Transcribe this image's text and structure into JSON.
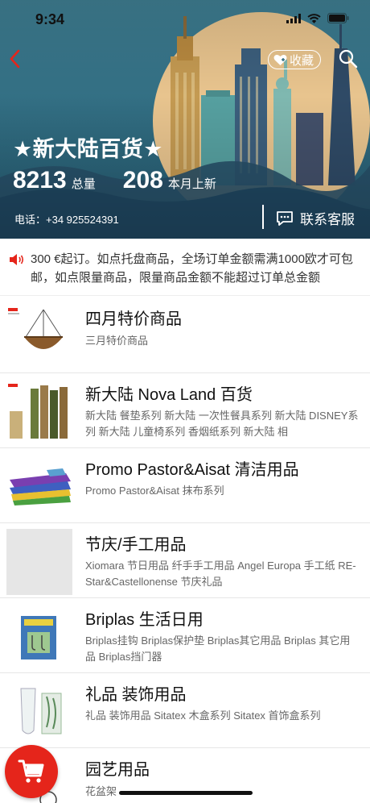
{
  "status_bar": {
    "time": "9:34"
  },
  "header": {
    "favorite_label": "收藏",
    "store_name": "★新大陆百货★",
    "total_count": "8213",
    "total_label": "总量",
    "new_count": "208",
    "new_label": "本月上新",
    "phone": "电话：+34 925524391",
    "contact_label": "联系客服"
  },
  "notice": {
    "text": "300 €起订。如点托盘商品，全场订单金额需满1000欧才可包邮，如点限量商品，限量商品金额不能超过订单总金额"
  },
  "categories": [
    {
      "title": "四月特价商品",
      "subtitle": "三月特价商品"
    },
    {
      "title": "新大陆 Nova Land 百货",
      "subtitle": "新大陆 餐垫系列 新大陆 一次性餐具系列 新大陆 DISNEY系列 新大陆 儿童椅系列 香烟纸系列 新大陆 相"
    },
    {
      "title": "Promo Pastor&Aisat 清洁用品",
      "subtitle": "Promo Pastor&Aisat 抹布系列"
    },
    {
      "title": "节庆/手工用品",
      "subtitle": "Xiomara 节日用品 纤手手工用品 Angel Europa 手工纸 RE-Star&Castellonense 节庆礼品"
    },
    {
      "title": "Briplas 生活日用",
      "subtitle": "Briplas挂钩 Briplas保护垫 Briplas其它用品 Briplas 其它用品 Briplas挡门器"
    },
    {
      "title": "礼品 装饰用品",
      "subtitle": "礼品 装饰用品 Sitatex 木盒系列 Sitatex 首饰盒系列"
    },
    {
      "title": "园艺用品",
      "subtitle": "花盆架"
    }
  ],
  "colors": {
    "accent": "#e5251b",
    "hero_bg": "#2f6a7f"
  }
}
